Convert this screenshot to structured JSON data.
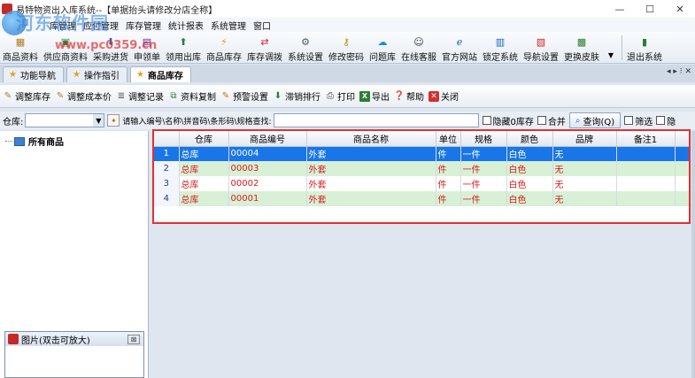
{
  "window": {
    "title": "易特物资出入库系统--【单据抬头请修改分店全称】",
    "minimize": "—",
    "maximize": "☐",
    "close": "✕"
  },
  "watermark": {
    "site": "河东软件园",
    "url": "www.pc0359.cn"
  },
  "menu": {
    "items": [
      "库管理",
      "应付管理",
      "库存管理",
      "统计报表",
      "系统管理",
      "窗口"
    ]
  },
  "toolbar": {
    "items": [
      {
        "label": "商品资料",
        "icon": "box-icon"
      },
      {
        "label": "供应商资料",
        "icon": "supplier-icon"
      },
      {
        "label": "采购进货",
        "icon": "purchase-icon"
      },
      {
        "label": "申领单",
        "icon": "requisition-icon"
      },
      {
        "label": "领用出库",
        "icon": "outbound-icon"
      },
      {
        "label": "商品库存",
        "icon": "inventory-icon"
      },
      {
        "label": "库存调拨",
        "icon": "transfer-icon"
      },
      {
        "label": "系统设置",
        "icon": "settings-icon"
      },
      {
        "label": "修改密码",
        "icon": "key-icon"
      },
      {
        "label": "问题库",
        "icon": "question-icon"
      },
      {
        "label": "在线客服",
        "icon": "support-icon"
      },
      {
        "label": "官方网站",
        "icon": "globe-icon"
      },
      {
        "label": "锁定系统",
        "icon": "lock-icon"
      },
      {
        "label": "导航设置",
        "icon": "navigation-icon"
      },
      {
        "label": "更换皮肤",
        "icon": "skin-icon"
      },
      {
        "label": "退出系统",
        "icon": "exit-icon"
      }
    ]
  },
  "tabs": [
    {
      "label": "功能导航",
      "active": false
    },
    {
      "label": "操作指引",
      "active": false
    },
    {
      "label": "商品库存",
      "active": true
    }
  ],
  "tab_nav": "◂ ▸ ⁝ ✕",
  "subtoolbar": {
    "items": [
      "调整库存",
      "调整成本价",
      "调整记录",
      "资料复制",
      "预警设置",
      "滞销排行",
      "打印",
      "导出",
      "帮助",
      "关闭"
    ]
  },
  "filter": {
    "warehouse_label": "仓库:",
    "search_hint": "请输入编号\\名称\\拼音码\\条形码\\规格查找:",
    "hide_zero_label": "隐藏0库存",
    "merge_label": "合并",
    "query_label": "查询(Q)",
    "filter_label": "筛选",
    "hide_label": "隐"
  },
  "tree": {
    "root": "所有商品"
  },
  "image_panel": {
    "title": "图片(双击可放大)",
    "close": "⊠"
  },
  "grid": {
    "columns": [
      "",
      "仓库",
      "商品编号",
      "商品名称",
      "单位",
      "规格",
      "颜色",
      "品牌",
      "备注1",
      ""
    ],
    "rows": [
      {
        "rn": "1",
        "warehouse": "总库",
        "code": "00004",
        "name": "外套",
        "unit": "件",
        "spec": "一件",
        "color": "白色",
        "brand": "无",
        "note": ""
      },
      {
        "rn": "2",
        "warehouse": "总库",
        "code": "00003",
        "name": "外套",
        "unit": "件",
        "spec": "一件",
        "color": "白色",
        "brand": "无",
        "note": ""
      },
      {
        "rn": "3",
        "warehouse": "总库",
        "code": "00002",
        "name": "外套",
        "unit": "件",
        "spec": "一件",
        "color": "白色",
        "brand": "无",
        "note": ""
      },
      {
        "rn": "4",
        "warehouse": "总库",
        "code": "00001",
        "name": "外套",
        "unit": "件",
        "spec": "一件",
        "color": "白色",
        "brand": "无",
        "note": ""
      }
    ]
  },
  "colors": {
    "selection": "#1976e8",
    "highlight_border": "#e53030",
    "row_alt": "#d8f0d6",
    "text_red": "#d81b1b"
  }
}
